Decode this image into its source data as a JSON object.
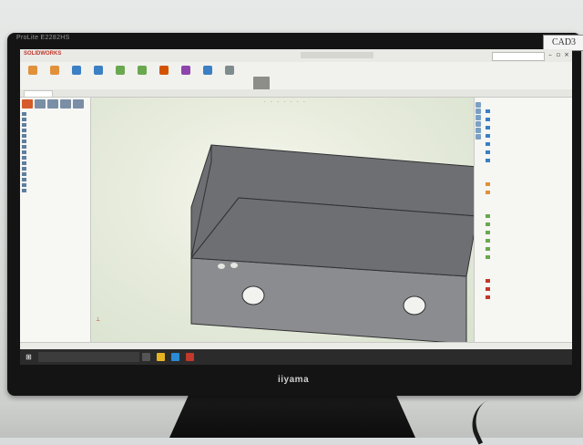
{
  "monitor": {
    "model_label": "ProLite E2282HS",
    "brand_label": "iiyama",
    "sticker_label": "CAD3"
  },
  "app": {
    "logo_text": "SOLIDWORKS",
    "document_title": "",
    "search_placeholder": "",
    "win_minimize": "–",
    "win_restore": "▫",
    "win_close": "×"
  },
  "ribbon": {
    "buttons": [
      {
        "label": "",
        "icon": "extrude-icon",
        "color": "#e0913a"
      },
      {
        "label": "",
        "icon": "revolve-icon",
        "color": "#e0913a"
      },
      {
        "label": "",
        "icon": "sweep-icon",
        "color": "#3b7fc4"
      },
      {
        "label": "",
        "icon": "cut-icon",
        "color": "#3b7fc4"
      },
      {
        "label": "",
        "icon": "fillet-icon",
        "color": "#6aa84f"
      },
      {
        "label": "",
        "icon": "pattern-icon",
        "color": "#6aa84f"
      },
      {
        "label": "",
        "icon": "rib-icon",
        "color": "#d35400"
      },
      {
        "label": "",
        "icon": "shell-icon",
        "color": "#8e44ad"
      },
      {
        "label": "",
        "icon": "curves-icon",
        "color": "#3b7fc4"
      },
      {
        "label": "",
        "icon": "instant3d-icon",
        "color": "#7f8c8d"
      }
    ]
  },
  "tabs": [
    {
      "label": "",
      "active": true
    },
    {
      "label": "",
      "active": false
    },
    {
      "label": "",
      "active": false
    },
    {
      "label": "",
      "active": false
    },
    {
      "label": "",
      "active": false
    },
    {
      "label": "",
      "active": false
    }
  ],
  "tree": {
    "rows": [
      "",
      "",
      "",
      "",
      "",
      "",
      "",
      "",
      "",
      "",
      "",
      "",
      "",
      "",
      ""
    ]
  },
  "viewport": {
    "heads_up_label": "· · · · · · ·",
    "triad_label": "⊥"
  },
  "taskpane": {
    "sections": [
      {
        "heading": "",
        "rows": [
          "",
          "",
          "",
          "",
          "",
          "",
          ""
        ]
      },
      {
        "heading": "",
        "rows": [
          "",
          ""
        ]
      },
      {
        "heading": "",
        "rows": [
          "",
          "",
          "",
          "",
          "",
          ""
        ]
      },
      {
        "heading": "",
        "rows": [
          "",
          "",
          ""
        ]
      }
    ],
    "paragraph": ""
  },
  "statusbar": {
    "text": ""
  },
  "taskbar": {
    "start_glyph": "⊞",
    "search_placeholder": "",
    "tray_text": "",
    "apps": [
      {
        "icon": "task-view-icon",
        "color": "#555555"
      },
      {
        "icon": "explorer-icon",
        "color": "#e6b422"
      },
      {
        "icon": "edge-icon",
        "color": "#2a8ad4"
      },
      {
        "icon": "solidworks-icon",
        "color": "#c0392b"
      }
    ]
  },
  "model": {
    "body_color": "#8a8c8f",
    "top_color": "#6d6f72",
    "edge_color": "#2f3133"
  }
}
